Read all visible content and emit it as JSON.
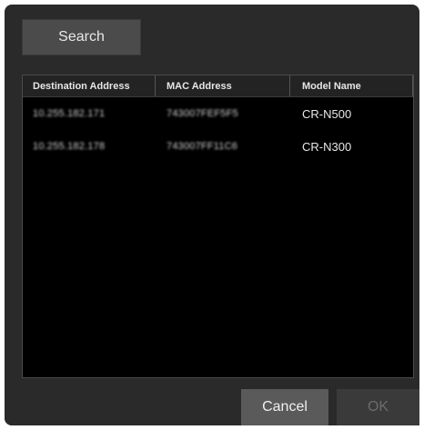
{
  "toolbar": {
    "search_label": "Search"
  },
  "table": {
    "columns": [
      "Destination Address",
      "MAC Address",
      "Model Name"
    ],
    "rows": [
      {
        "destination": "10.255.182.171",
        "mac": "743007FEF5F5",
        "model": "CR-N500"
      },
      {
        "destination": "10.255.182.178",
        "mac": "743007FF11C6",
        "model": "CR-N300"
      }
    ]
  },
  "footer": {
    "cancel_label": "Cancel",
    "ok_label": "OK"
  }
}
